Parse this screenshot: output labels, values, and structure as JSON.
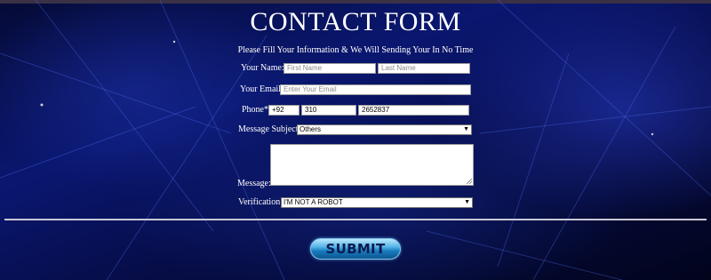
{
  "form": {
    "title": "CONTACT FORM",
    "subtitle": "Please Fill Your Information & We Will Sending Your In No Time",
    "name_label": "Your Name:",
    "first_name_placeholder": "First Name",
    "last_name_placeholder": "Last Name",
    "email_label": "Your Email",
    "email_placeholder": "Enter Your Email",
    "phone_label": "Phone*",
    "phone_country_value": "+92",
    "phone_area_value": "310",
    "phone_number_value": "2652837",
    "subject_label": "Message Subject",
    "subject_selected": "Others",
    "message_label": "Message:",
    "verification_label": "Verification:",
    "verification_selected": "I'M NOT A ROBOT",
    "submit_label": "SUBMIT"
  },
  "colors": {
    "background_dark": "#050a35",
    "background_blue": "#0a1770",
    "submit_blue": "#1a7cc0",
    "text": "#ffffff"
  }
}
